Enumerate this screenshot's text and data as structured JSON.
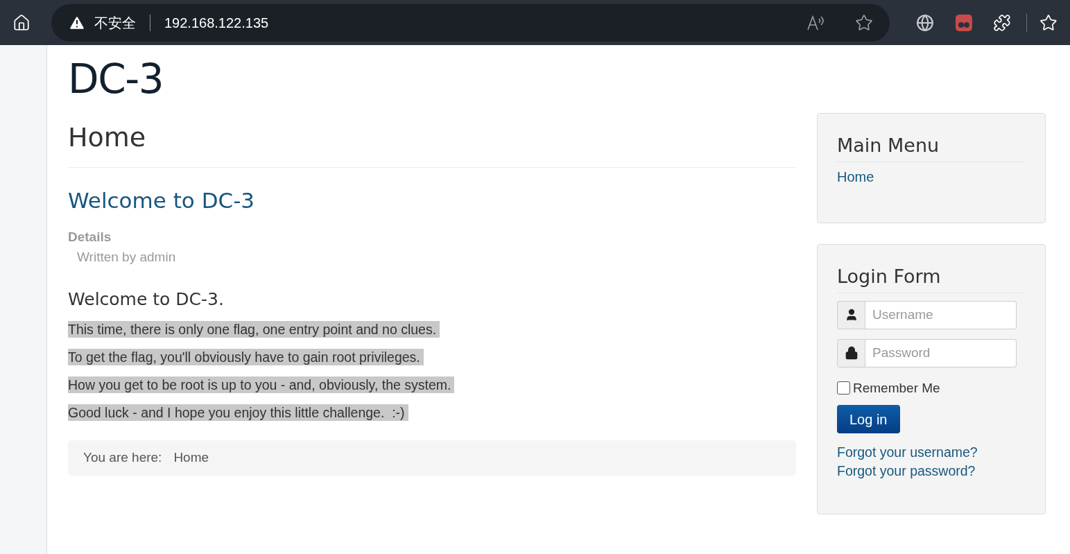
{
  "browser": {
    "security_label": "不安全",
    "address": "192.168.122.135"
  },
  "site_title": "DC-3",
  "page_heading": "Home",
  "article": {
    "title": "Welcome to DC-3",
    "details_label": "Details",
    "author": "Written by admin",
    "heading": "Welcome to DC-3.",
    "paragraphs": [
      {
        "text": "This time, there is only one flag, one entry point and no clues.",
        "selected": true
      },
      {
        "text": "To get the flag, you'll obviously have to gain root privileges.",
        "selected": true
      },
      {
        "text": "How you get to be root is up to you - and, obviously, the system.",
        "selected": true
      },
      {
        "text": "Good luck - and I hope you enjoy this little challenge.  :-)",
        "selected": true
      }
    ]
  },
  "breadcrumb": {
    "label": "You are here:",
    "items": [
      "Home"
    ]
  },
  "main_menu": {
    "title": "Main Menu",
    "items": [
      "Home"
    ]
  },
  "login_form": {
    "title": "Login Form",
    "username": {
      "placeholder": "Username"
    },
    "password": {
      "placeholder": "Password"
    },
    "remember": {
      "label": "Remember Me",
      "checked": false
    },
    "submit": "Log in",
    "links": [
      "Forgot your username?",
      "Forgot your password?"
    ]
  }
}
